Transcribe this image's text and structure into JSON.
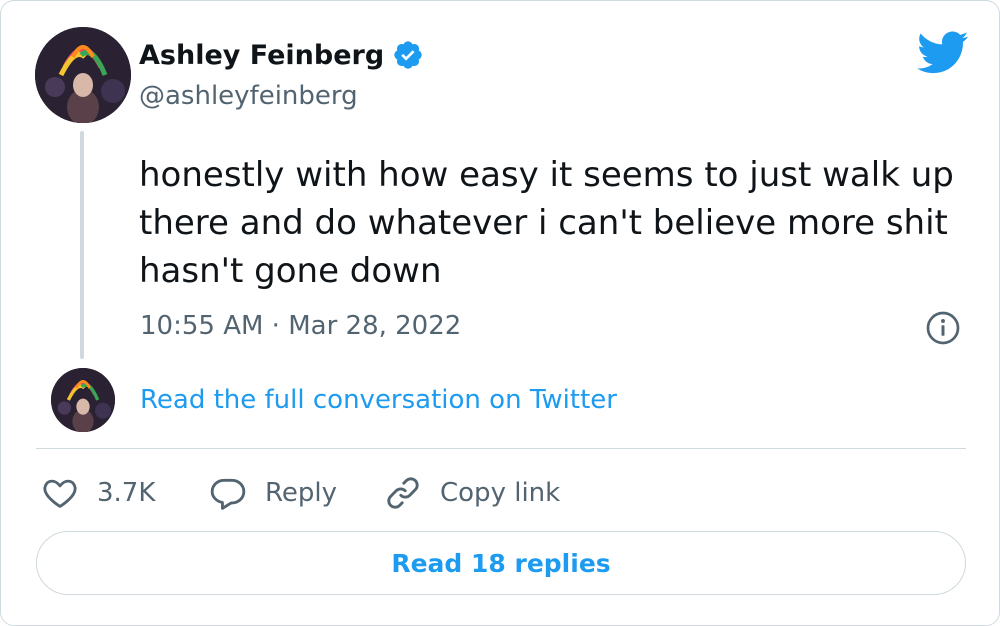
{
  "author": {
    "name": "Ashley Feinberg",
    "handle": "@ashleyfeinberg",
    "verified": true
  },
  "tweet": {
    "text": "honestly with how easy it seems to just walk up there and do whatever i can't believe more shit hasn't gone down",
    "timestamp": "10:55 AM · Mar 28, 2022"
  },
  "conversation": {
    "link_text": "Read the full conversation on Twitter"
  },
  "actions": {
    "like_count": "3.7K",
    "reply_label": "Reply",
    "copy_link_label": "Copy link"
  },
  "replies_button": {
    "label": "Read 18 replies"
  },
  "icons": {
    "brand": "twitter-bird-icon",
    "verified": "verified-badge-icon",
    "info": "info-icon",
    "like": "heart-icon",
    "reply": "speech-bubble-icon",
    "copy": "link-icon"
  },
  "colors": {
    "accent": "#1d9bf0",
    "text": "#0f1419",
    "secondary": "#536471",
    "border": "#cfd9de"
  }
}
